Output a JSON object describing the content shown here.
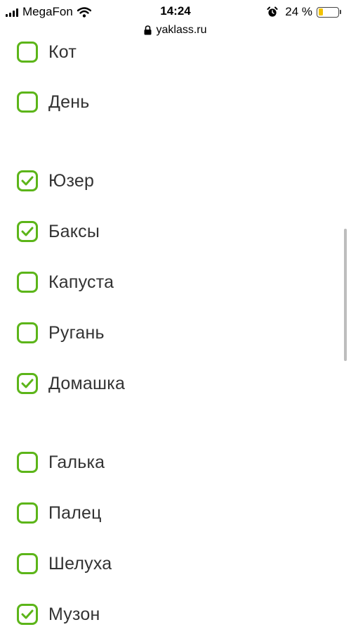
{
  "status_bar": {
    "carrier": "MegaFon",
    "time": "14:24",
    "battery_percent": "24 %",
    "battery_level": 0.24,
    "battery_color": "#f2c200",
    "signal_icon": "signal-bars-icon",
    "wifi_icon": "wifi-icon",
    "alarm_icon": "alarm-clock-icon"
  },
  "browser": {
    "url": "yaklass.ru",
    "lock_icon": "lock-icon"
  },
  "accent_color": "#5cb519",
  "options": [
    {
      "label": "Кот",
      "checked": false
    },
    {
      "label": "День",
      "checked": false
    },
    {
      "label": "Юзер",
      "checked": true
    },
    {
      "label": "Баксы",
      "checked": true
    },
    {
      "label": "Капуста",
      "checked": false
    },
    {
      "label": "Ругань",
      "checked": false
    },
    {
      "label": "Домашка",
      "checked": true
    },
    {
      "label": "Галька",
      "checked": false
    },
    {
      "label": "Палец",
      "checked": false
    },
    {
      "label": "Шелуха",
      "checked": false
    },
    {
      "label": "Музон",
      "checked": true
    }
  ]
}
